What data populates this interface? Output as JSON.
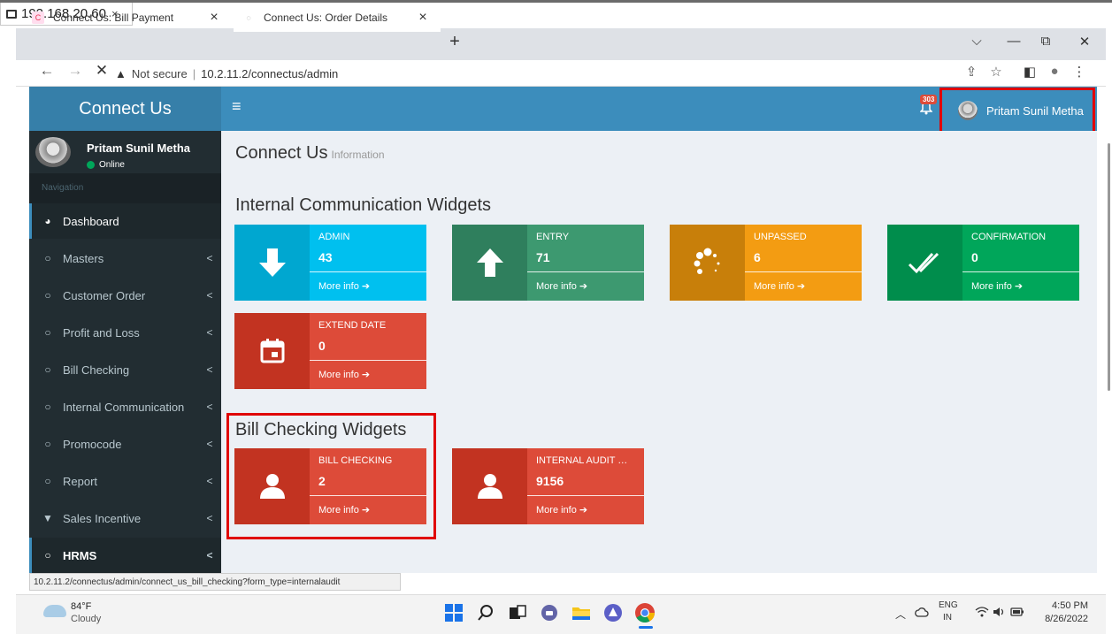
{
  "remote": {
    "title": "192.168.20.60",
    "close": "×"
  },
  "browser": {
    "tabs": [
      {
        "title": "Connect Us: Bill Payment",
        "close": "×",
        "favicon": "C",
        "favicon_color": "#e35"
      },
      {
        "title": "Connect Us: Order Details",
        "close": "×",
        "favicon": "◌",
        "favicon_color": "#888"
      }
    ],
    "new_tab": "+",
    "window_controls": {
      "minimize": "—",
      "restore": "⧉",
      "close": "✕",
      "dropdown": "⌵"
    },
    "nav": {
      "back": "←",
      "forward": "→",
      "stop": "✕"
    },
    "address": {
      "warning": "▲",
      "not_secure": "Not secure",
      "separator": "|",
      "url": "10.2.11.2/connectus/admin"
    },
    "toolbar": {
      "share": "⇪",
      "star": "☆",
      "side_panel": "◧",
      "profile": "●",
      "menu": "⋮"
    }
  },
  "app": {
    "logo": "Connect Us",
    "hamburger": "≡",
    "notifications": {
      "icon": "🔔",
      "count": "303"
    },
    "user_name": "Pritam Sunil Metha"
  },
  "sidebar": {
    "user": {
      "name": "Pritam Sunil Metha",
      "status": "Online"
    },
    "header": "Navigation",
    "items": [
      {
        "label": "Dashboard",
        "icon": "◕",
        "chevron": "",
        "active": true
      },
      {
        "label": "Masters",
        "icon": "○",
        "chevron": "<"
      },
      {
        "label": "Customer Order",
        "icon": "○",
        "chevron": "<"
      },
      {
        "label": "Profit and Loss",
        "icon": "○",
        "chevron": "<"
      },
      {
        "label": "Bill Checking",
        "icon": "○",
        "chevron": "<"
      },
      {
        "label": "Internal Communication",
        "icon": "○",
        "chevron": "<"
      },
      {
        "label": "Promocode",
        "icon": "○",
        "chevron": "<"
      },
      {
        "label": "Report",
        "icon": "○",
        "chevron": "<"
      },
      {
        "label": "Sales Incentive",
        "icon": "▼",
        "chevron": "<"
      },
      {
        "label": "HRMS",
        "icon": "○",
        "chevron": "<"
      }
    ]
  },
  "content": {
    "title": "Connect Us",
    "subtitle": "Information",
    "section1": {
      "title": "Internal Communication Widgets",
      "widgets": [
        {
          "label": "ADMIN",
          "number": "43",
          "more": "More info ➔",
          "icon": "arrow-down",
          "color": "#00c0ef",
          "icon_bg": "#00a7d0"
        },
        {
          "label": "ENTRY",
          "number": "71",
          "more": "More info ➔",
          "icon": "arrow-up",
          "color": "#3d9970",
          "icon_bg": "#2f7f5d"
        },
        {
          "label": "UNPASSED",
          "number": "6",
          "more": "More info ➔",
          "icon": "spinner",
          "color": "#f39c12",
          "icon_bg": "#db8b0b"
        },
        {
          "label": "CONFIRMATION",
          "number": "0",
          "more": "More info ➔",
          "icon": "double-check",
          "color": "#00a65a",
          "icon_bg": "#008d4c"
        },
        {
          "label": "EXTEND DATE",
          "number": "0",
          "more": "More info ➔",
          "icon": "calendar",
          "color": "#dd4b39",
          "icon_bg": "#c23321"
        }
      ]
    },
    "section2": {
      "title": "Bill Checking Widgets",
      "widgets": [
        {
          "label": "BILL CHECKING",
          "number": "2",
          "more": "More info ➔",
          "icon": "user",
          "color": "#dd4b39",
          "icon_bg": "#c23321"
        },
        {
          "label": "INTERNAL AUDIT …",
          "number": "9156",
          "more": "More info ➔",
          "icon": "user",
          "color": "#dd4b39",
          "icon_bg": "#c23321"
        }
      ]
    }
  },
  "status_url": "10.2.11.2/connectus/admin/connect_us_bill_checking?form_type=internalaudit",
  "taskbar": {
    "weather": {
      "temp": "84°F",
      "condition": "Cloudy"
    },
    "tray": {
      "chevron": "︿",
      "lang1": "ENG",
      "lang2": "IN",
      "time": "4:50 PM",
      "date": "8/26/2022"
    }
  }
}
